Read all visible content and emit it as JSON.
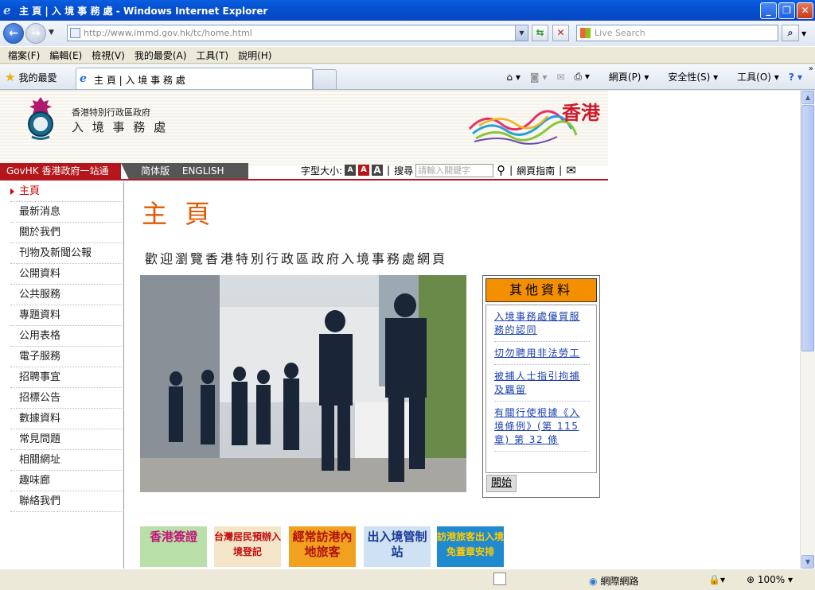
{
  "window": {
    "title": "主 頁 | 入 境 事 務 處 - Windows Internet Explorer"
  },
  "address": {
    "url": "http://www.immd.gov.hk/tc/home.html",
    "search_placeholder": "Live Search"
  },
  "menu": [
    "檔案(F)",
    "編輯(E)",
    "檢視(V)",
    "我的最愛(A)",
    "工具(T)",
    "說明(H)"
  ],
  "favorites_label": "我的最愛",
  "tab": {
    "label": "主 頁 | 入 境 事 務 處"
  },
  "commands": {
    "page": "網頁(P)",
    "safety": "安全性(S)",
    "tools": "工具(O)"
  },
  "site": {
    "dept_line1": "香港特別行政區政府",
    "dept_line2": "入 境 事 務 處",
    "brand": "香港",
    "govhk": "GovHK 香港政府一站通",
    "lang_simplified": "简体版",
    "lang_english": "ENGLISH",
    "font_size_label": "字型大小:",
    "search_label": "搜尋",
    "search_placeholder": "請輸入關鍵字",
    "site_guide": "網頁指南"
  },
  "nav": [
    "主頁",
    "最新消息",
    "關於我們",
    "刊物及新聞公報",
    "公開資料",
    "公共服務",
    "專題資料",
    "公用表格",
    "電子服務",
    "招聘事宜",
    "招標公告",
    "數據資料",
    "常見問題",
    "相關網址",
    "趣味廊",
    "聯絡我們"
  ],
  "main": {
    "title": "主 頁",
    "welcome": "歡迎瀏覽香港特別行政區政府入境事務處網頁",
    "others_title": "其他資料",
    "others_links": [
      "入境事務處優質服務的認同",
      "切勿聘用非法勞工",
      "被捕人士指引拘捕及羈留",
      "有關行使根據《入境條例》(第 115 章) 第 32 條"
    ],
    "start_button": "開始"
  },
  "promos": [
    {
      "text": "香港簽證",
      "bg": "#b8e0a8",
      "fg": "#c0187a"
    },
    {
      "text": "台灣居民預辦入境登記",
      "bg": "#f4e4c8",
      "fg": "#c01010"
    },
    {
      "text": "經常訪港內地旅客",
      "bg": "#f2a020",
      "fg": "#b01010"
    },
    {
      "text": "出入境管制站",
      "bg": "#cfe2f4",
      "fg": "#1a3a9a"
    },
    {
      "text": "訪港旅客出入境免蓋章安排",
      "bg": "#1f8ad0",
      "fg": "#ffcc00"
    }
  ],
  "status": {
    "zone": "網際網路",
    "zoom": "100%"
  }
}
